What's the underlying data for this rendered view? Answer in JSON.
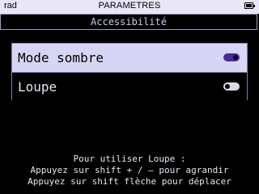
{
  "statusbar": {
    "left": "rad",
    "title": "PARAMETRES",
    "battery_icon": "battery-full-icon"
  },
  "header": {
    "title": "Accessibilité"
  },
  "settings": [
    {
      "label": "Mode sombre",
      "enabled": true
    },
    {
      "label": "Loupe",
      "enabled": false
    }
  ],
  "help": {
    "line1": "Pour utiliser Loupe :",
    "line2": "Appuyez sur shift + / – pour agrandir",
    "line3": "Appuyez sur shift flèche pour déplacer"
  },
  "colors": {
    "statusbar_bg": "#e8e6f7",
    "selected_row_bg": "#d6d6f4",
    "toggle_on": "#4a2a9a",
    "toggle_off": "#d9d9e6"
  }
}
